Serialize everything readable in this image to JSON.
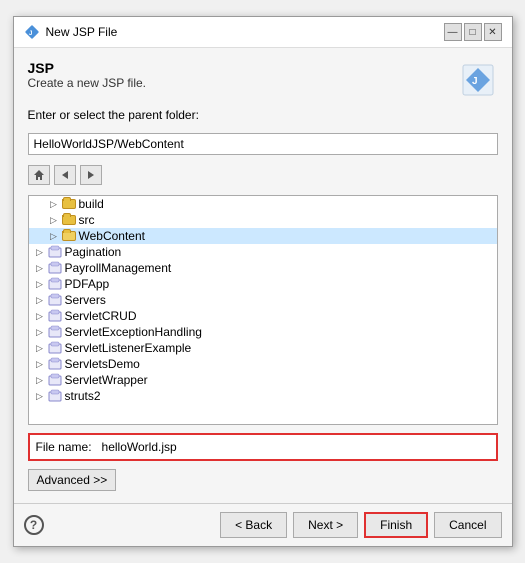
{
  "dialog": {
    "title": "New JSP File",
    "header": {
      "title": "JSP",
      "subtitle": "Create a new JSP file."
    }
  },
  "folder_section": {
    "label": "Enter or select the parent folder:",
    "value": "HelloWorldJSP/WebContent"
  },
  "tree": {
    "items": [
      {
        "id": "build",
        "label": "build",
        "level": 2,
        "expanded": true,
        "selected": false
      },
      {
        "id": "src",
        "label": "src",
        "level": 2,
        "expanded": false,
        "selected": false
      },
      {
        "id": "webcontent",
        "label": "WebContent",
        "level": 2,
        "expanded": false,
        "selected": true
      },
      {
        "id": "pagination",
        "label": "Pagination",
        "level": 1,
        "expanded": false,
        "selected": false
      },
      {
        "id": "payroll",
        "label": "PayrollManagement",
        "level": 1,
        "expanded": false,
        "selected": false
      },
      {
        "id": "pdfapp",
        "label": "PDFApp",
        "level": 1,
        "expanded": false,
        "selected": false
      },
      {
        "id": "servers",
        "label": "Servers",
        "level": 1,
        "expanded": false,
        "selected": false
      },
      {
        "id": "servletcrud",
        "label": "ServletCRUD",
        "level": 1,
        "expanded": false,
        "selected": false
      },
      {
        "id": "servletex",
        "label": "ServletExceptionHandling",
        "level": 1,
        "expanded": false,
        "selected": false
      },
      {
        "id": "servletlistener",
        "label": "ServletListenerExample",
        "level": 1,
        "expanded": false,
        "selected": false
      },
      {
        "id": "servletsdemo",
        "label": "ServletsDemo",
        "level": 1,
        "expanded": false,
        "selected": false
      },
      {
        "id": "servletwrapper",
        "label": "ServletWrapper",
        "level": 1,
        "expanded": false,
        "selected": false
      },
      {
        "id": "struts2",
        "label": "struts2",
        "level": 1,
        "expanded": false,
        "selected": false
      }
    ]
  },
  "file_name": {
    "label": "File name:",
    "value": "helloWorld.jsp",
    "placeholder": ""
  },
  "buttons": {
    "advanced": "Advanced >>",
    "help": "?",
    "back": "< Back",
    "next": "Next >",
    "finish": "Finish",
    "cancel": "Cancel"
  }
}
